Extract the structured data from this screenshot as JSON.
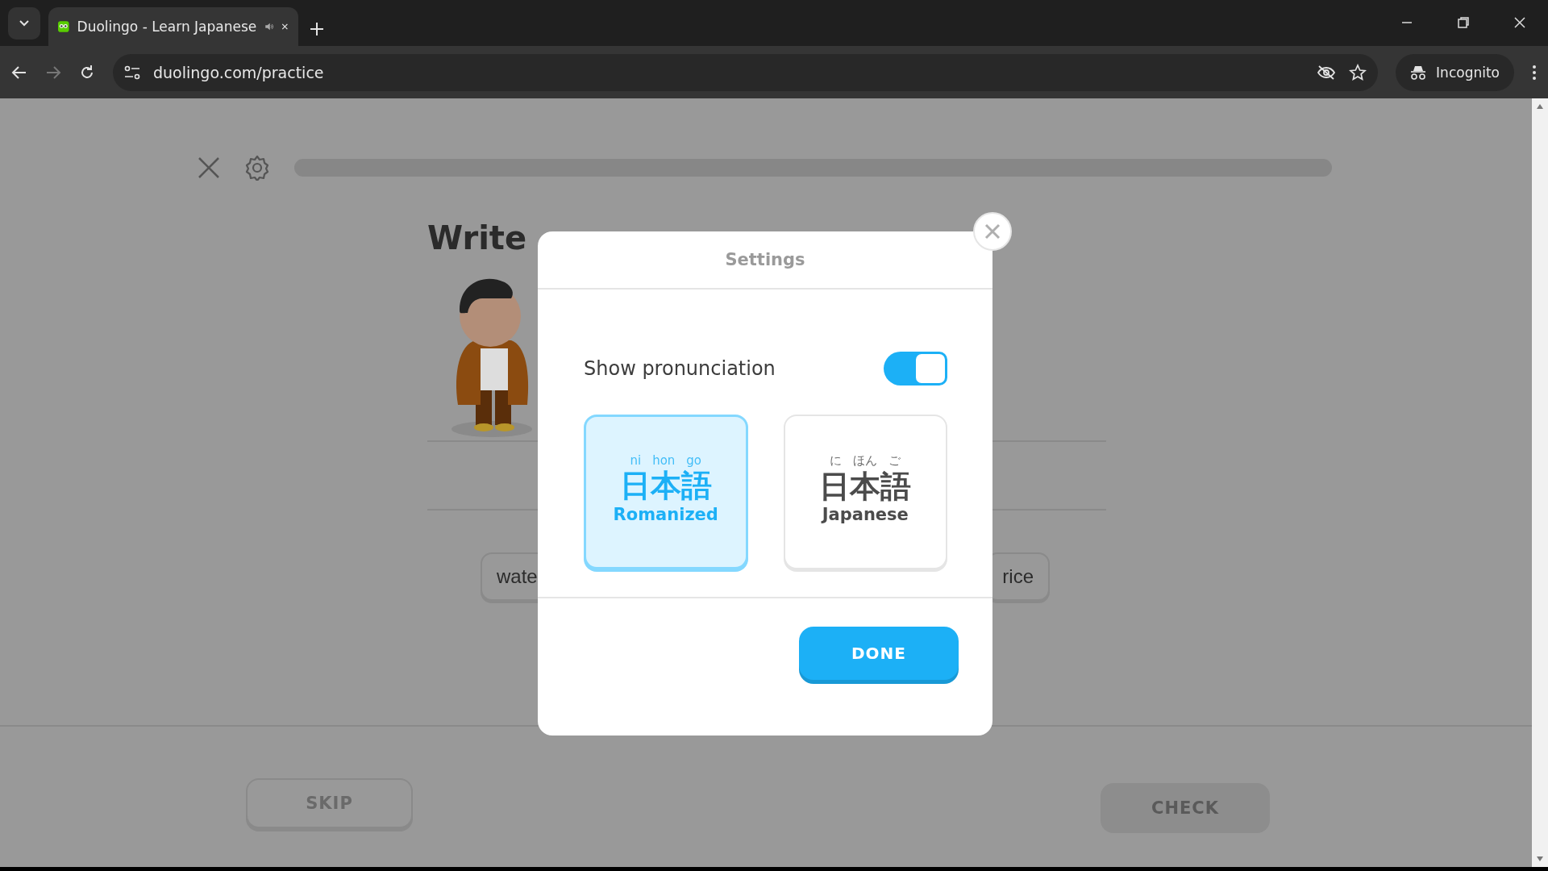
{
  "browser": {
    "tab": {
      "title": "Duolingo - Learn Japanese",
      "playing_audio": true
    },
    "address": "duolingo.com/practice",
    "profile": "Incognito"
  },
  "lesson": {
    "title": "Write",
    "word_bank": [
      "wate",
      "rice"
    ],
    "skip": "SKIP",
    "check": {
      "label": "CHECK",
      "disabled": true
    }
  },
  "settings_dialog": {
    "title": "Settings",
    "toggle": {
      "label": "Show pronunciation",
      "on": true
    },
    "options": [
      {
        "reading": [
          "ni",
          "hon",
          "go"
        ],
        "script": "日本語",
        "label": "Romanized",
        "selected": true
      },
      {
        "reading": [
          "に",
          "ほん",
          "ご"
        ],
        "script": "日本語",
        "label": "Japanese",
        "selected": false
      }
    ],
    "done": "DONE"
  }
}
